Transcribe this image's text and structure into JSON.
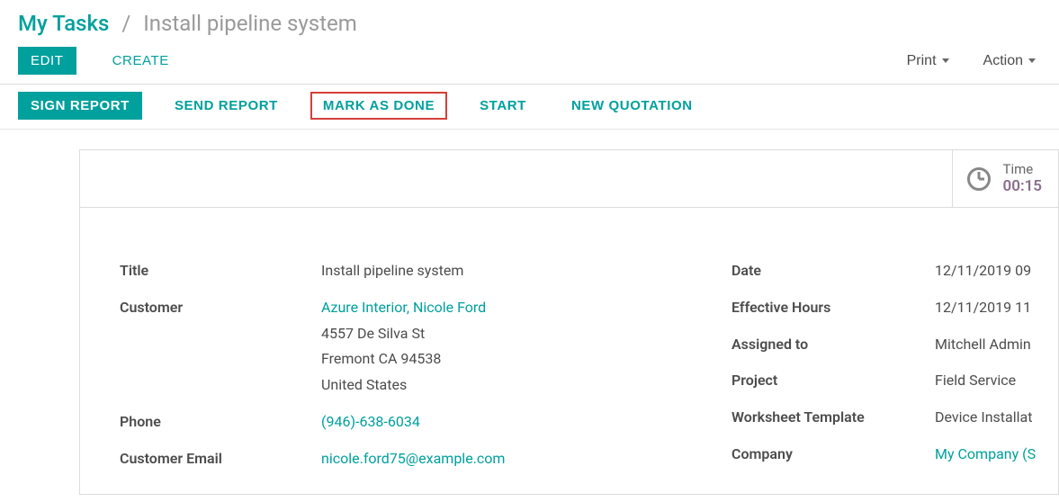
{
  "breadcrumb": {
    "root": "My Tasks",
    "separator": "/",
    "leaf": "Install pipeline system"
  },
  "toolbar": {
    "edit": "EDIT",
    "create": "CREATE",
    "print": "Print",
    "action": "Action"
  },
  "actions": {
    "sign_report": "SIGN REPORT",
    "send_report": "SEND REPORT",
    "mark_as_done": "MARK AS DONE",
    "start": "START",
    "new_quotation": "NEW QUOTATION"
  },
  "timer": {
    "label": "Time",
    "value": "00:15"
  },
  "left_fields": {
    "title": {
      "label": "Title",
      "value": "Install pipeline system"
    },
    "customer": {
      "label": "Customer",
      "name": "Azure Interior, Nicole Ford",
      "street": "4557 De Silva St",
      "city_line": "Fremont CA 94538",
      "country": "United States"
    },
    "phone": {
      "label": "Phone",
      "value": "(946)-638-6034"
    },
    "email": {
      "label": "Customer Email",
      "value": "nicole.ford75@example.com"
    }
  },
  "right_fields": {
    "date": {
      "label": "Date",
      "value": "12/11/2019 09"
    },
    "effective_hours": {
      "label": "Effective Hours",
      "value": "12/11/2019 11"
    },
    "assigned_to": {
      "label": "Assigned to",
      "value": "Mitchell Admin"
    },
    "project": {
      "label": "Project",
      "value": "Field Service"
    },
    "worksheet_template": {
      "label": "Worksheet Template",
      "value": "Device Installat"
    },
    "company": {
      "label": "Company",
      "value": "My Company (S"
    }
  }
}
